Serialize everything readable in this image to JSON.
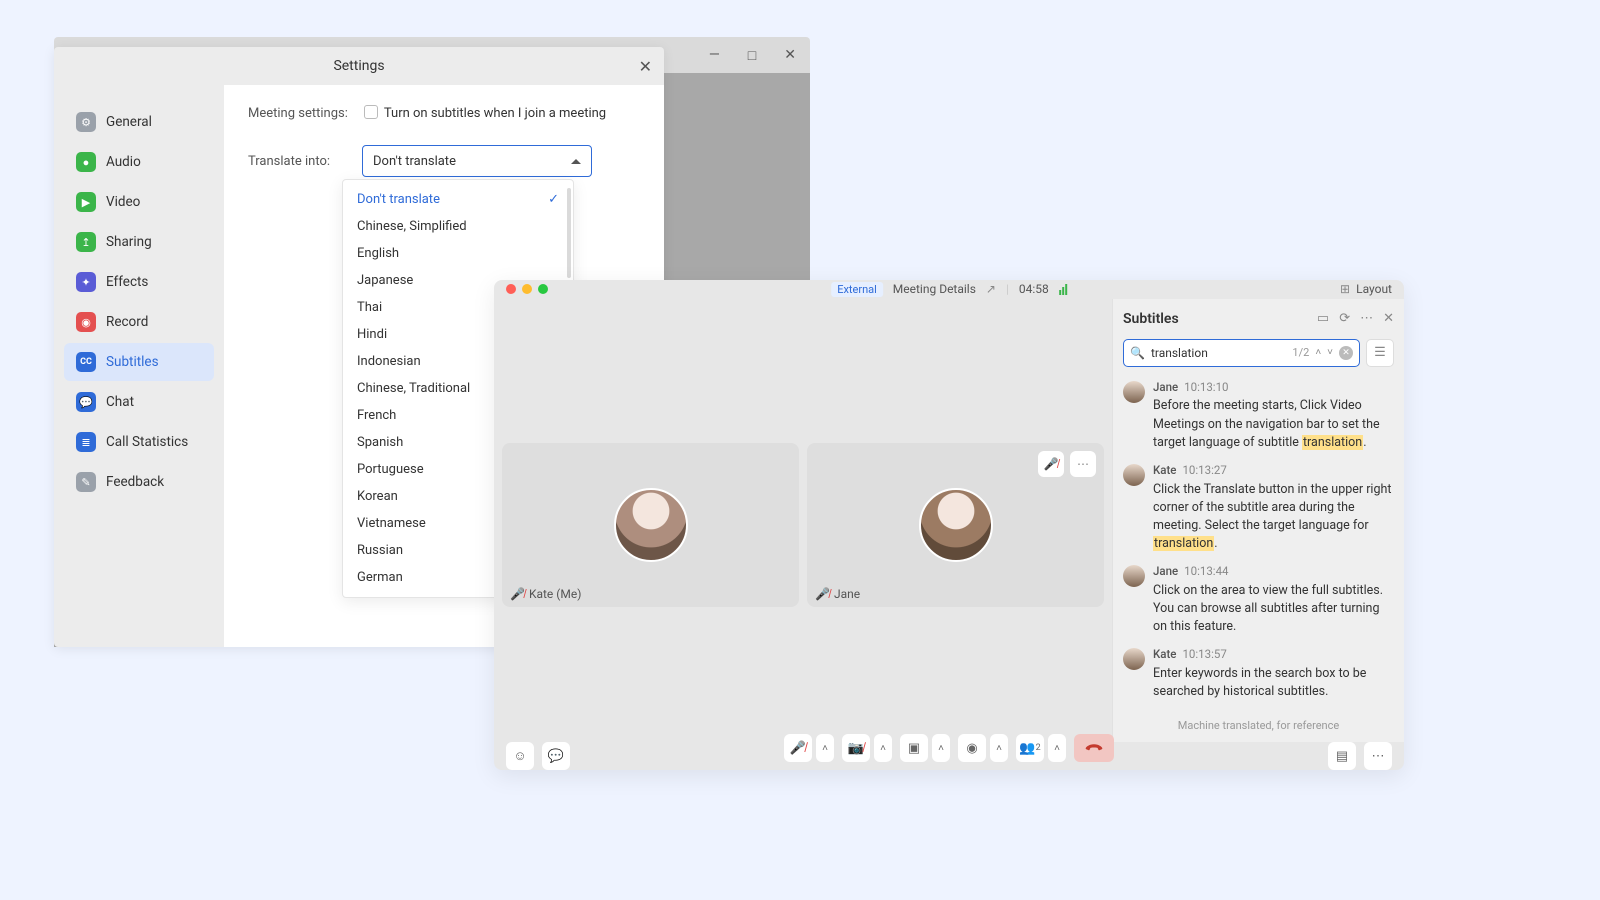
{
  "bg_window": {
    "minimize": "—",
    "maximize": "□",
    "close": "✕"
  },
  "settings": {
    "title": "Settings",
    "nav": {
      "general": "General",
      "audio": "Audio",
      "video": "Video",
      "sharing": "Sharing",
      "effects": "Effects",
      "record": "Record",
      "subtitles": "Subtitles",
      "chat": "Chat",
      "call_stats": "Call Statistics",
      "feedback": "Feedback"
    },
    "main": {
      "meeting_settings_label": "Meeting settings:",
      "subtitle_join_checkbox": "Turn on subtitles when I join a meeting",
      "translate_into_label": "Translate into:",
      "translate_selected": "Don't translate",
      "options": [
        "Don't translate",
        "Chinese, Simplified",
        "English",
        "Japanese",
        "Thai",
        "Hindi",
        "Indonesian",
        "Chinese, Traditional",
        "French",
        "Spanish",
        "Portuguese",
        "Korean",
        "Vietnamese",
        "Russian",
        "German"
      ]
    }
  },
  "meeting": {
    "top": {
      "external_badge": "External",
      "details": "Meeting Details",
      "timer": "04:58",
      "layout_label": "Layout"
    },
    "tiles": {
      "left_name": "Kate (Me)",
      "right_name": "Jane"
    },
    "subtitles_panel": {
      "title": "Subtitles",
      "search_value": "translation",
      "search_count": "1/2",
      "entries": [
        {
          "name": "Jane",
          "time": "10:13:10",
          "text_pre": "Before the meeting starts, Click Video Meetings on the navigation bar to set the target language of subtitle ",
          "hl": "translation",
          "text_post": "."
        },
        {
          "name": "Kate",
          "time": "10:13:27",
          "text_pre": "Click the Translate button in the upper right corner of the subtitle area during the meeting. Select the target language for ",
          "hl": "translation",
          "text_post": "."
        },
        {
          "name": "Jane",
          "time": "10:13:44",
          "text_pre": "Click on the area to view the full subtitles. You can browse all subtitles after turning on this feature.",
          "hl": "",
          "text_post": ""
        },
        {
          "name": "Kate",
          "time": "10:13:57",
          "text_pre": "Enter keywords in the search box to be searched by historical subtitles.",
          "hl": "",
          "text_post": ""
        }
      ],
      "footer": "Machine translated, for reference"
    }
  }
}
